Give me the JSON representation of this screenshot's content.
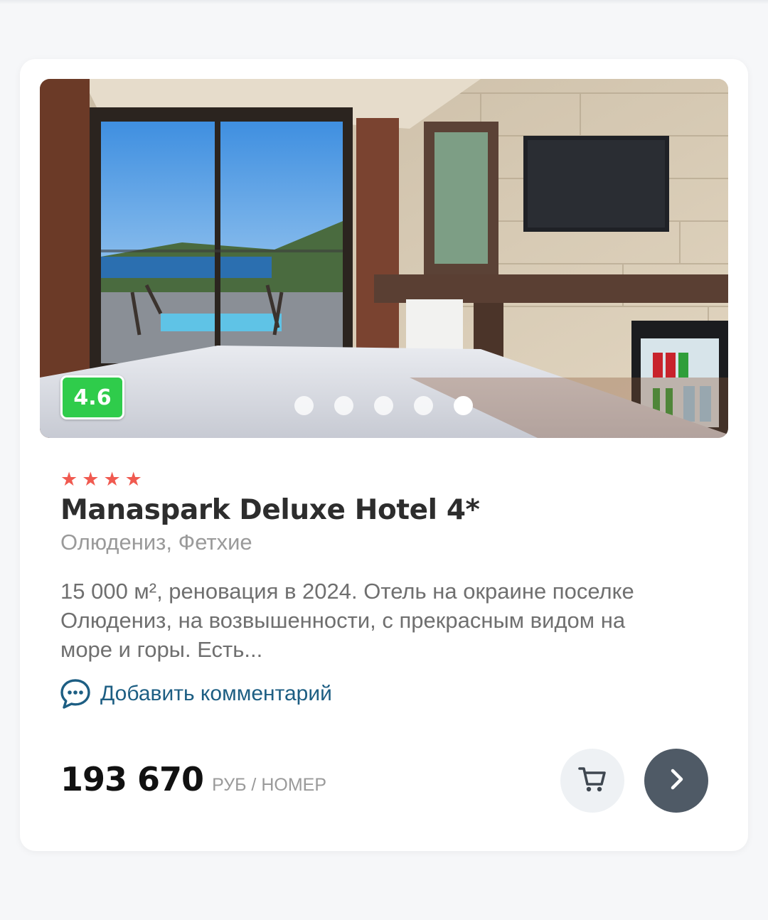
{
  "hotel": {
    "rating": "4.6",
    "stars": 4,
    "star_glyph": "★",
    "name": "Manaspark Deluxe Hotel 4*",
    "location": "Олюдениз, Фетхие",
    "description": "15 000 м², реновация в 2024. Отель на окраине поселке Олюдениз, на возвышенности, с прекрасным видом на море и горы. Есть...",
    "gallery": {
      "total_photos": 5,
      "active_index": 4
    }
  },
  "comment": {
    "label": "Добавить комментарий",
    "icon": "chat-bubble-icon"
  },
  "price": {
    "value": "193 670",
    "unit": "РУБ / НОМЕР"
  },
  "actions": {
    "cart_icon": "cart-icon",
    "next_icon": "chevron-right-icon"
  },
  "colors": {
    "rating_badge": "#2fcc4b",
    "stars": "#f05a50",
    "link": "#1d5e83",
    "next_button": "#4f5a66",
    "cart_button": "#eef1f4"
  }
}
